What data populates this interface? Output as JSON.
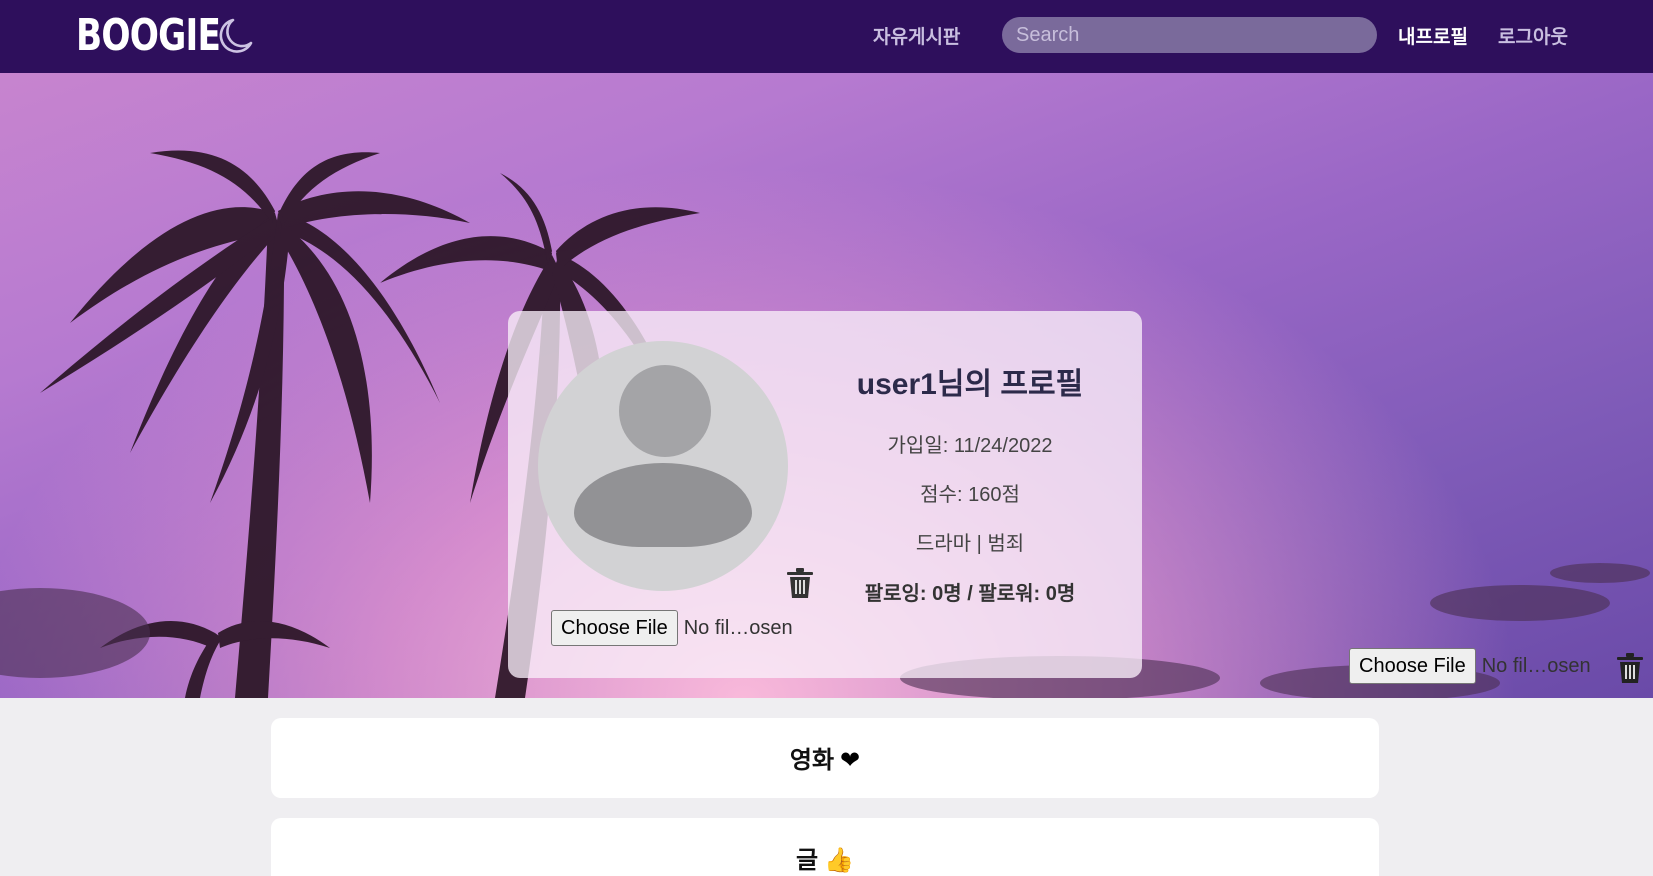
{
  "navbar": {
    "logo": "BOOGIE",
    "board_link": "자유게시판",
    "search_placeholder": "Search",
    "profile_link": "내프로필",
    "logout_link": "로그아웃"
  },
  "profile": {
    "title": "user1님의 프로필",
    "joined": "가입일: 11/24/2022",
    "score": "점수: 160점",
    "genres": "드라마 | 범죄",
    "follow": "팔로잉: 0명 / 팔로워: 0명",
    "avatar_file_button": "Choose File",
    "avatar_file_name": "No fil…osen"
  },
  "banner": {
    "file_button": "Choose File",
    "file_name": "No fil…osen"
  },
  "sections": [
    {
      "title": "영화",
      "icon": "❤"
    },
    {
      "title": "글",
      "icon": "👍"
    }
  ],
  "colors": {
    "navbar": "#2e0f5c",
    "search_bg": "#7a6a9b",
    "page_bg": "#efeef1"
  }
}
